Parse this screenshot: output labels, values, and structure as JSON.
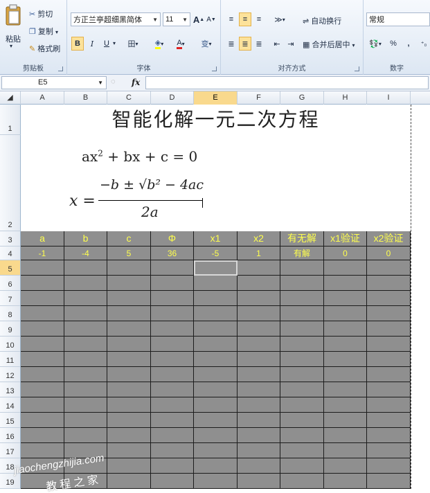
{
  "ribbon": {
    "clipboard": {
      "paste": "粘贴",
      "cut": "剪切",
      "copy": "复制",
      "format_painter": "格式刷",
      "label": "剪贴板"
    },
    "font": {
      "name": "方正兰亭超细黑简体",
      "size": "11",
      "grow": "A",
      "shrink": "A",
      "bold": "B",
      "italic": "I",
      "underline": "U",
      "border": "田",
      "fill": "A",
      "color": "A",
      "phonetic": "变",
      "label": "字体"
    },
    "alignment": {
      "wrap_text": "自动换行",
      "merge_center": "合并后居中",
      "label": "对齐方式"
    },
    "number": {
      "format": "常规",
      "percent": "%",
      "comma": ",",
      "label": "数字"
    }
  },
  "formula_bar": {
    "name_box": "E5",
    "fx": "fx",
    "formula": ""
  },
  "columns": [
    "A",
    "B",
    "C",
    "D",
    "E",
    "F",
    "G",
    "H",
    "I"
  ],
  "rows": [
    "1",
    "2",
    "3",
    "4",
    "5",
    "6",
    "7",
    "8",
    "9",
    "10",
    "11",
    "12",
    "13",
    "14",
    "15",
    "16",
    "17",
    "18",
    "19"
  ],
  "sheet": {
    "title": "智能化解一元二次方程",
    "equation": "ax² + bx + c = 0",
    "formula_x": "x =",
    "formula_num": "−b ± √b² − 4ac",
    "formula_den": "2a",
    "headers": [
      "a",
      "b",
      "c",
      "Φ",
      "x1",
      "x2",
      "有无解",
      "x1验证",
      "x2验证"
    ],
    "values": [
      "-1",
      "-4",
      "5",
      "36",
      "-5",
      "1",
      "有解",
      "0",
      "0"
    ]
  },
  "watermark": {
    "line1": "jiaochengzhijia.com",
    "line2": "教程之家"
  },
  "colors": {
    "sheet_fill": "#8f8f8f",
    "header_text": "#ffff4d",
    "selected_header": "#f9d98d"
  }
}
